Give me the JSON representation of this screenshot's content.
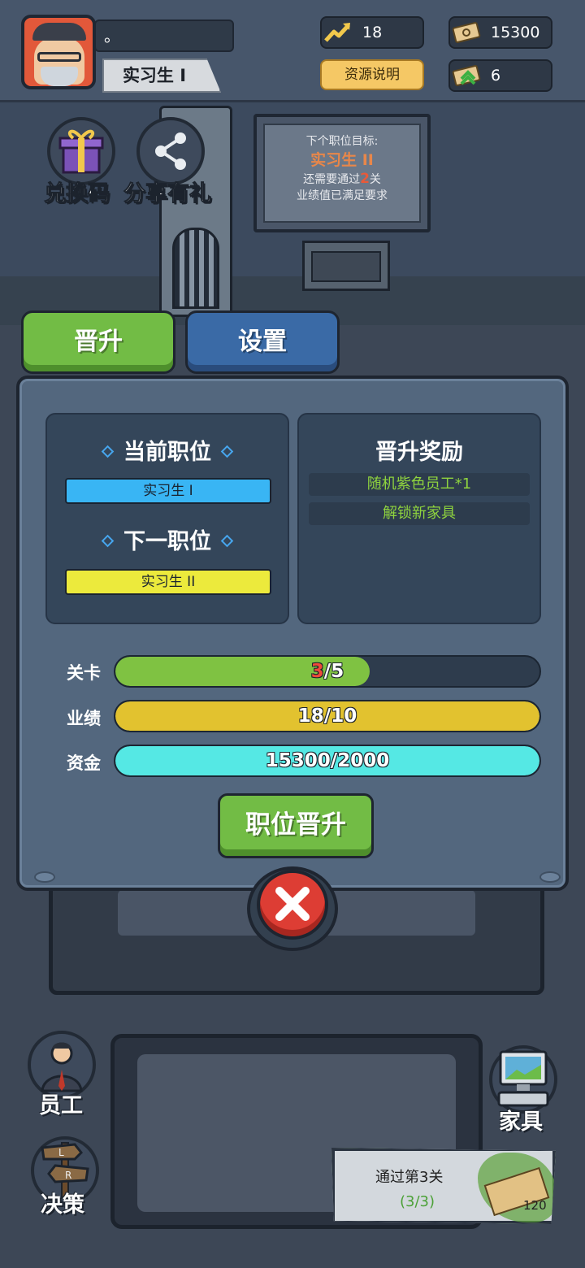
{
  "player": {
    "name": "。",
    "rank": "实习生 I"
  },
  "resources": {
    "performance": "18",
    "cash": "15300",
    "promo_tickets": "6",
    "explain_button": "资源说明"
  },
  "features": {
    "redeem": "兑换码",
    "share": "分享有礼"
  },
  "board": {
    "line1": "下个职位目标:",
    "position": "实习生 II",
    "line3_prefix": "还需要通过",
    "line3_num": "2",
    "line3_suffix": "关",
    "line4": "业绩值已满足要求"
  },
  "tabs": {
    "promote": "晋升",
    "settings": "设置"
  },
  "panel": {
    "current_title": "当前职位",
    "current_value": "实习生 I",
    "next_title": "下一职位",
    "next_value": "实习生 II",
    "reward_title": "晋升奖励",
    "rewards": [
      "随机紫色员工*1",
      "解锁新家具"
    ],
    "requirements": [
      {
        "label": "关卡",
        "current": "3",
        "sep_total": "/5",
        "ratio": 0.6,
        "color": "#7fc242"
      },
      {
        "label": "业绩",
        "text": "18/10",
        "ratio": 1.0,
        "color": "#e2c22f"
      },
      {
        "label": "资金",
        "text": "15300/2000",
        "ratio": 1.0,
        "color": "#55e8e4"
      }
    ],
    "promote_button": "职位晋升"
  },
  "bottom": {
    "staff": "员工",
    "furniture": "家具",
    "decision": "决策",
    "task_title": "通过第3关",
    "task_progress": "(3/3)",
    "task_reward": "120"
  },
  "colors": {
    "green_button": "#72bc45",
    "blue_button": "#3a6aa6",
    "panel": "#53677e",
    "card": "#34465a",
    "current_pos": "#39b5f4",
    "next_pos": "#ecea3c",
    "reward_text": "#8fd43e",
    "close_red": "#dd3d34"
  },
  "icons": {
    "performance": "trend-up-icon",
    "cash": "money-bill-icon",
    "tickets": "promo-ticket-icon",
    "redeem": "gift-box-icon",
    "share": "share-icon",
    "close": "close-x-icon",
    "staff": "employee-icon",
    "furniture": "computer-icon",
    "decision": "signpost-icon"
  }
}
